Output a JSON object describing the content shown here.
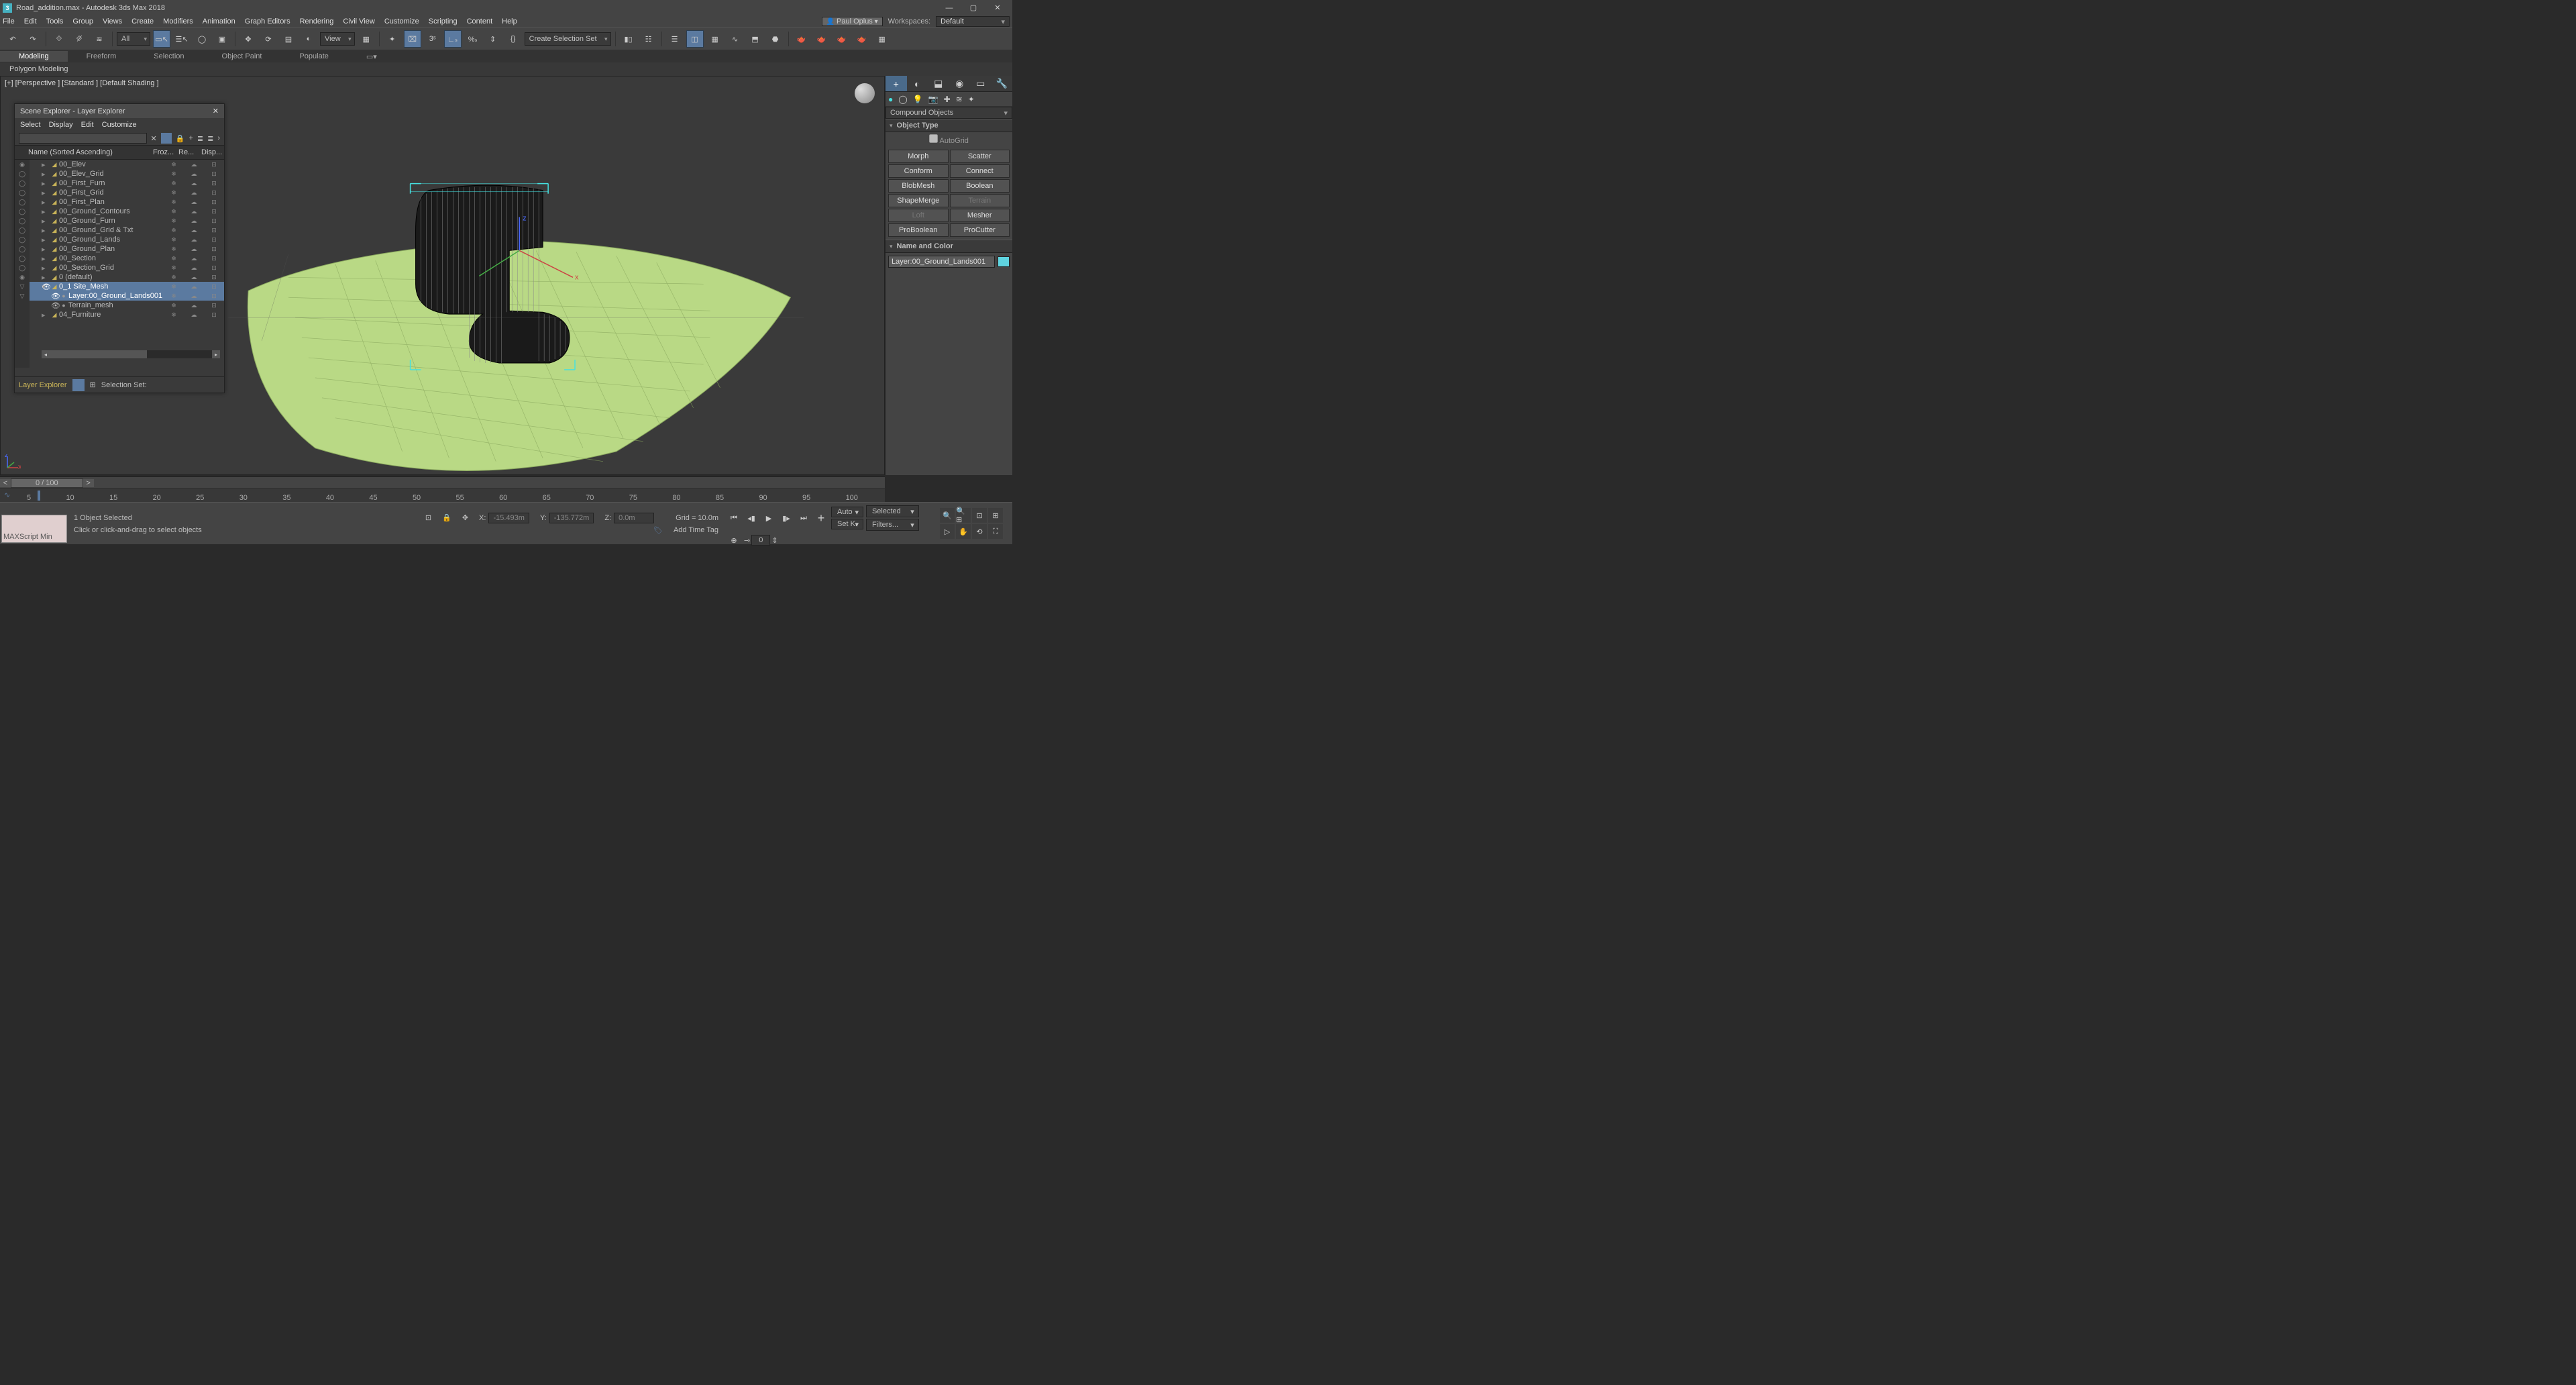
{
  "title": "Road_addition.max - Autodesk 3ds Max 2018",
  "menubar": [
    "File",
    "Edit",
    "Tools",
    "Group",
    "Views",
    "Create",
    "Modifiers",
    "Animation",
    "Graph Editors",
    "Rendering",
    "Civil View",
    "Customize",
    "Scripting",
    "Content",
    "Help"
  ],
  "signin": "Paul Oplus",
  "workspaces_label": "Workspaces:",
  "workspace": "Default",
  "toolbar": {
    "all": "All",
    "view": "View",
    "selset": "Create Selection Set"
  },
  "ribbon": {
    "tabs": [
      "Modeling",
      "Freeform",
      "Selection",
      "Object Paint",
      "Populate"
    ],
    "active": 0,
    "sub": "Polygon Modeling"
  },
  "viewport": {
    "label": "[+] [Perspective ]  [Standard ]  [Default Shading ]",
    "axis_x": "x",
    "axis_z": "z",
    "axis_far": "x"
  },
  "scene": {
    "title": "Scene Explorer - Layer Explorer",
    "menu": [
      "Select",
      "Display",
      "Edit",
      "Customize"
    ],
    "cols": [
      "Name (Sorted Ascending)",
      "Froz...",
      "Re...",
      "Disp..."
    ],
    "rows": [
      {
        "nm": "00_Elev",
        "ind": 1,
        "ic": "folder"
      },
      {
        "nm": "00_Elev_Grid",
        "ind": 1,
        "ic": "folder"
      },
      {
        "nm": "00_First_Furn",
        "ind": 1,
        "ic": "folder"
      },
      {
        "nm": "00_First_Grid",
        "ind": 1,
        "ic": "folder"
      },
      {
        "nm": "00_First_Plan",
        "ind": 1,
        "ic": "folder"
      },
      {
        "nm": "00_Ground_Contours",
        "ind": 1,
        "ic": "folder"
      },
      {
        "nm": "00_Ground_Furn",
        "ind": 1,
        "ic": "folder"
      },
      {
        "nm": "00_Ground_Grid & Txt",
        "ind": 1,
        "ic": "folder"
      },
      {
        "nm": "00_Ground_Lands",
        "ind": 1,
        "ic": "folder"
      },
      {
        "nm": "00_Ground_Plan",
        "ind": 1,
        "ic": "folder"
      },
      {
        "nm": "00_Section",
        "ind": 1,
        "ic": "folder"
      },
      {
        "nm": "00_Section_Grid",
        "ind": 1,
        "ic": "folder"
      },
      {
        "nm": "0 (default)",
        "ind": 1,
        "ic": "folder"
      },
      {
        "nm": "0_1 Site_Mesh",
        "ind": 1,
        "ic": "folder",
        "sel": true,
        "open": true
      },
      {
        "nm": "Layer:00_Ground_Lands001",
        "ind": 2,
        "ic": "obj",
        "sel": true,
        "childsel": true
      },
      {
        "nm": "Terrain_mesh",
        "ind": 2,
        "ic": "obj"
      },
      {
        "nm": "04_Furniture",
        "ind": 1,
        "ic": "folder"
      }
    ],
    "footer_mode": "Layer Explorer",
    "footer_sel": "Selection Set:"
  },
  "cmdpanel": {
    "dropdown": "Compound Objects",
    "objtype": "Object Type",
    "autogrid": "AutoGrid",
    "buttons": [
      [
        "Morph",
        "Scatter"
      ],
      [
        "Conform",
        "Connect"
      ],
      [
        "BlobMesh",
        "Boolean"
      ],
      [
        "ShapeMerge",
        "Terrain"
      ],
      [
        "Loft",
        "Mesher"
      ],
      [
        "ProBoolean",
        "ProCutter"
      ]
    ],
    "disabled": [
      "Terrain",
      "Loft"
    ],
    "namecolor": "Name and Color",
    "objname": "Layer:00_Ground_Lands001"
  },
  "timeline": {
    "pos": "0 / 100",
    "ticks": [
      "5",
      "10",
      "15",
      "20",
      "25",
      "30",
      "35",
      "40",
      "45",
      "50",
      "55",
      "60",
      "65",
      "70",
      "75",
      "80",
      "85",
      "90",
      "95",
      "100"
    ]
  },
  "status": {
    "script": "MAXScript Min",
    "selcount": "1 Object Selected",
    "prompt": "Click or click-and-drag to select objects",
    "x_lbl": "X:",
    "x": "-15.493m",
    "y_lbl": "Y:",
    "y": "-135.772m",
    "z_lbl": "Z:",
    "z": "0.0m",
    "grid": "Grid = 10.0m",
    "addtag": "Add Time Tag",
    "auto": "Auto",
    "setk": "Set K.",
    "frame": "0",
    "selected": "Selected",
    "filters": "Filters..."
  }
}
